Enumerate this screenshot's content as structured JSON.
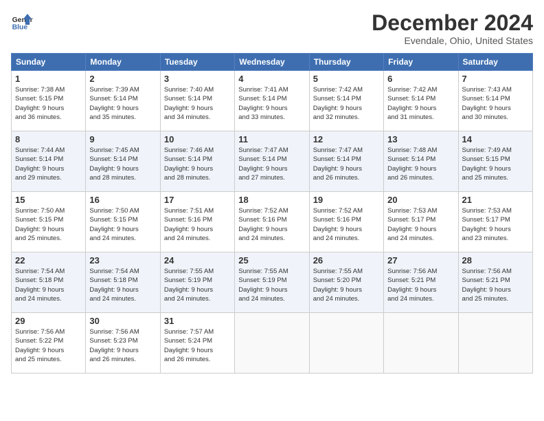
{
  "logo": {
    "line1": "General",
    "line2": "Blue"
  },
  "title": "December 2024",
  "subtitle": "Evendale, Ohio, United States",
  "weekdays": [
    "Sunday",
    "Monday",
    "Tuesday",
    "Wednesday",
    "Thursday",
    "Friday",
    "Saturday"
  ],
  "weeks": [
    [
      {
        "day": "1",
        "info": "Sunrise: 7:38 AM\nSunset: 5:15 PM\nDaylight: 9 hours\nand 36 minutes."
      },
      {
        "day": "2",
        "info": "Sunrise: 7:39 AM\nSunset: 5:14 PM\nDaylight: 9 hours\nand 35 minutes."
      },
      {
        "day": "3",
        "info": "Sunrise: 7:40 AM\nSunset: 5:14 PM\nDaylight: 9 hours\nand 34 minutes."
      },
      {
        "day": "4",
        "info": "Sunrise: 7:41 AM\nSunset: 5:14 PM\nDaylight: 9 hours\nand 33 minutes."
      },
      {
        "day": "5",
        "info": "Sunrise: 7:42 AM\nSunset: 5:14 PM\nDaylight: 9 hours\nand 32 minutes."
      },
      {
        "day": "6",
        "info": "Sunrise: 7:42 AM\nSunset: 5:14 PM\nDaylight: 9 hours\nand 31 minutes."
      },
      {
        "day": "7",
        "info": "Sunrise: 7:43 AM\nSunset: 5:14 PM\nDaylight: 9 hours\nand 30 minutes."
      }
    ],
    [
      {
        "day": "8",
        "info": "Sunrise: 7:44 AM\nSunset: 5:14 PM\nDaylight: 9 hours\nand 29 minutes."
      },
      {
        "day": "9",
        "info": "Sunrise: 7:45 AM\nSunset: 5:14 PM\nDaylight: 9 hours\nand 28 minutes."
      },
      {
        "day": "10",
        "info": "Sunrise: 7:46 AM\nSunset: 5:14 PM\nDaylight: 9 hours\nand 28 minutes."
      },
      {
        "day": "11",
        "info": "Sunrise: 7:47 AM\nSunset: 5:14 PM\nDaylight: 9 hours\nand 27 minutes."
      },
      {
        "day": "12",
        "info": "Sunrise: 7:47 AM\nSunset: 5:14 PM\nDaylight: 9 hours\nand 26 minutes."
      },
      {
        "day": "13",
        "info": "Sunrise: 7:48 AM\nSunset: 5:14 PM\nDaylight: 9 hours\nand 26 minutes."
      },
      {
        "day": "14",
        "info": "Sunrise: 7:49 AM\nSunset: 5:15 PM\nDaylight: 9 hours\nand 25 minutes."
      }
    ],
    [
      {
        "day": "15",
        "info": "Sunrise: 7:50 AM\nSunset: 5:15 PM\nDaylight: 9 hours\nand 25 minutes."
      },
      {
        "day": "16",
        "info": "Sunrise: 7:50 AM\nSunset: 5:15 PM\nDaylight: 9 hours\nand 24 minutes."
      },
      {
        "day": "17",
        "info": "Sunrise: 7:51 AM\nSunset: 5:16 PM\nDaylight: 9 hours\nand 24 minutes."
      },
      {
        "day": "18",
        "info": "Sunrise: 7:52 AM\nSunset: 5:16 PM\nDaylight: 9 hours\nand 24 minutes."
      },
      {
        "day": "19",
        "info": "Sunrise: 7:52 AM\nSunset: 5:16 PM\nDaylight: 9 hours\nand 24 minutes."
      },
      {
        "day": "20",
        "info": "Sunrise: 7:53 AM\nSunset: 5:17 PM\nDaylight: 9 hours\nand 24 minutes."
      },
      {
        "day": "21",
        "info": "Sunrise: 7:53 AM\nSunset: 5:17 PM\nDaylight: 9 hours\nand 23 minutes."
      }
    ],
    [
      {
        "day": "22",
        "info": "Sunrise: 7:54 AM\nSunset: 5:18 PM\nDaylight: 9 hours\nand 24 minutes."
      },
      {
        "day": "23",
        "info": "Sunrise: 7:54 AM\nSunset: 5:18 PM\nDaylight: 9 hours\nand 24 minutes."
      },
      {
        "day": "24",
        "info": "Sunrise: 7:55 AM\nSunset: 5:19 PM\nDaylight: 9 hours\nand 24 minutes."
      },
      {
        "day": "25",
        "info": "Sunrise: 7:55 AM\nSunset: 5:19 PM\nDaylight: 9 hours\nand 24 minutes."
      },
      {
        "day": "26",
        "info": "Sunrise: 7:55 AM\nSunset: 5:20 PM\nDaylight: 9 hours\nand 24 minutes."
      },
      {
        "day": "27",
        "info": "Sunrise: 7:56 AM\nSunset: 5:21 PM\nDaylight: 9 hours\nand 24 minutes."
      },
      {
        "day": "28",
        "info": "Sunrise: 7:56 AM\nSunset: 5:21 PM\nDaylight: 9 hours\nand 25 minutes."
      }
    ],
    [
      {
        "day": "29",
        "info": "Sunrise: 7:56 AM\nSunset: 5:22 PM\nDaylight: 9 hours\nand 25 minutes."
      },
      {
        "day": "30",
        "info": "Sunrise: 7:56 AM\nSunset: 5:23 PM\nDaylight: 9 hours\nand 26 minutes."
      },
      {
        "day": "31",
        "info": "Sunrise: 7:57 AM\nSunset: 5:24 PM\nDaylight: 9 hours\nand 26 minutes."
      },
      null,
      null,
      null,
      null
    ]
  ]
}
